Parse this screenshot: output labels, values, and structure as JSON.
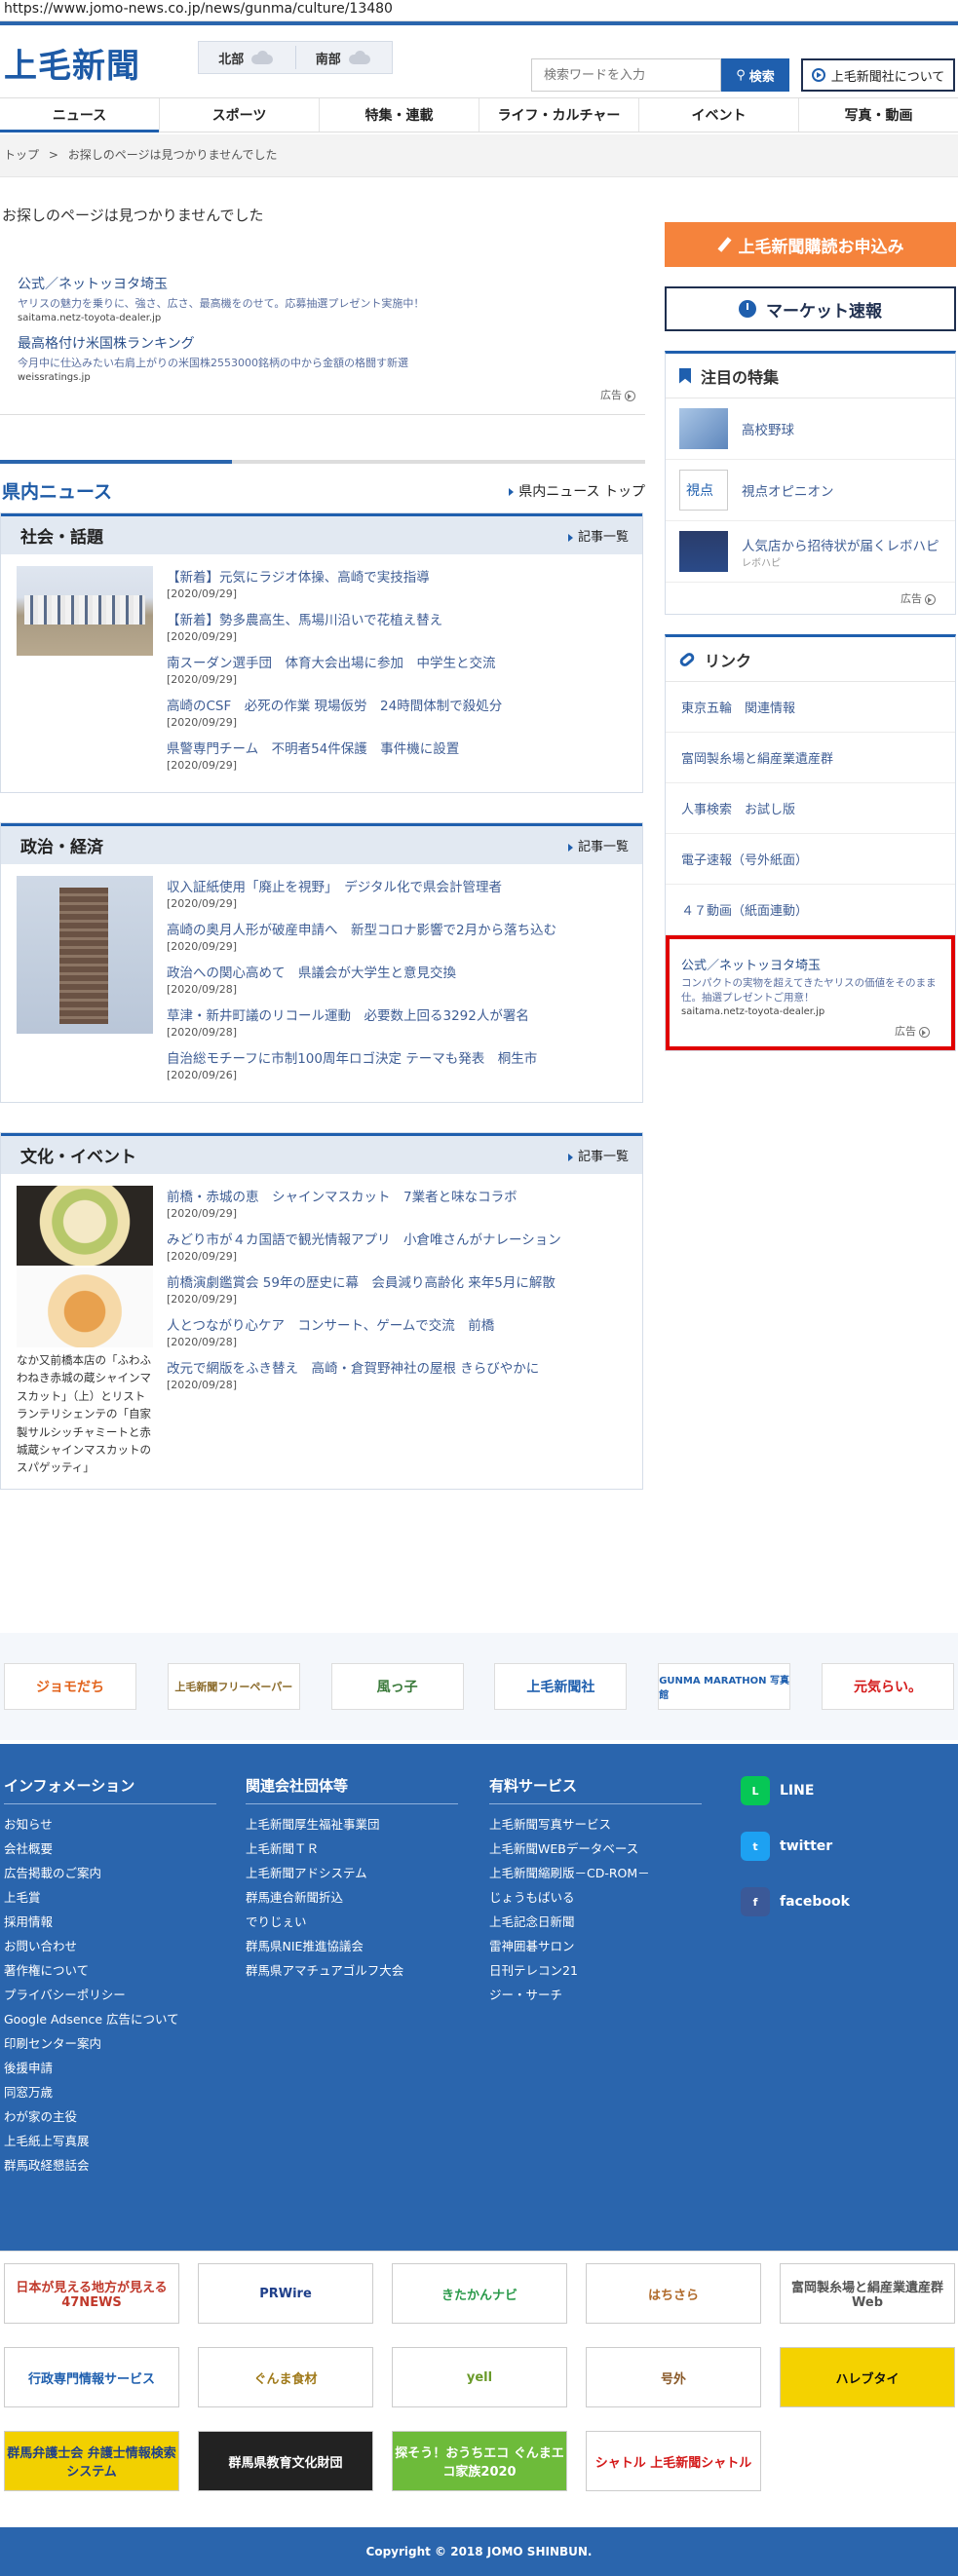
{
  "url": "https://www.jomo-news.co.jp/news/gunma/culture/13480",
  "header": {
    "logo": "上毛新聞",
    "weather": [
      {
        "area": "北部"
      },
      {
        "area": "南部"
      }
    ],
    "search_placeholder": "検索ワードを入力",
    "search_label": "検索",
    "about_label": "上毛新聞社について"
  },
  "nav": [
    "ニュース",
    "スポーツ",
    "特集・連載",
    "ライフ・カルチャー",
    "イベント",
    "写真・動画"
  ],
  "breadcrumb": {
    "home": "トップ",
    "sep": ">",
    "current": "お探しのページは見つかりませんでした"
  },
  "notfound": "お探しのページは見つかりませんでした",
  "ads": [
    {
      "title": "公式／ネットッヨタ埼玉",
      "desc": "ヤリスの魅力を乗りに、強さ、広さ、最高機をのせて。応募抽選プレゼント実施中！",
      "url": "saitama.netz-toyota-dealer.jp"
    },
    {
      "title": "最高格付け米国株ランキング",
      "desc": "今月中に仕込みたい右肩上がりの米国株2553000銘柄の中から金額の格闘す新選",
      "url": "weissratings.jp"
    }
  ],
  "ad_label": "広告",
  "progress": 0.36,
  "kennai": {
    "title": "県内ニュース",
    "link": "県内ニュース トップ"
  },
  "sections": [
    {
      "title": "社会・話題",
      "more": "記事一覧",
      "articles": [
        {
          "title": "【新着】元気にラジオ体操、高崎で実技指導",
          "date": "[2020/09/29]"
        },
        {
          "title": "【新着】勢多農高生、馬場川沿いで花植え替え",
          "date": "[2020/09/29]"
        },
        {
          "title": "南スーダン選手団　体育大会出場に参加　中学生と交流",
          "date": "[2020/09/29]"
        },
        {
          "title": "高崎のCSF　必死の作業 現場仮労　24時間体制で殺処分",
          "date": "[2020/09/29]"
        },
        {
          "title": "県警専門チーム　不明者54件保護　事件機に設置",
          "date": "[2020/09/29]"
        }
      ]
    },
    {
      "title": "政治・経済",
      "more": "記事一覧",
      "articles": [
        {
          "title": "収入証紙使用「廃止を視野」　デジタル化で県会計管理者",
          "date": "[2020/09/29]"
        },
        {
          "title": "高崎の奥月人形が破産申請へ　新型コロナ影響で2月から落ち込む",
          "date": "[2020/09/29]"
        },
        {
          "title": "政治への関心高めて　県議会が大学生と意見交換",
          "date": "[2020/09/28]"
        },
        {
          "title": "草津・新井町議のリコール運動　必要数上回る3292人が署名",
          "date": "[2020/09/28]"
        },
        {
          "title": "自治総モチーフに市制100周年ロゴ決定 テーマも発表　桐生市",
          "date": "[2020/09/26]"
        }
      ]
    },
    {
      "title": "文化・イベント",
      "more": "記事一覧",
      "caption": "なか又前橋本店の「ふわふわねき赤城の蔵シャインマスカット」（上）とリストランテリシェンテの「自家製サルシッチャミートと赤城蔵シャインマスカットのスパゲッティ」",
      "articles": [
        {
          "title": "前橋・赤城の恵　シャインマスカット　7業者と味なコラボ",
          "date": "[2020/09/29]"
        },
        {
          "title": "みどり市が４カ国語で観光情報アプリ　小倉唯さんがナレーション",
          "date": "[2020/09/29]"
        },
        {
          "title": "前橋演劇鑑賞会 59年の歴史に幕　会員減り高齢化 来年5月に解散",
          "date": "[2020/09/29]"
        },
        {
          "title": "人とつながり心ケア　コンサート、ゲームで交流　前橋",
          "date": "[2020/09/28]"
        },
        {
          "title": "改元で網版をふき替え　高崎・倉賀野神社の屋根 きらびやかに",
          "date": "[2020/09/28]"
        }
      ]
    }
  ],
  "side": {
    "apply": "上毛新聞購読お申込み",
    "market": "マーケット速報",
    "features_title": "注目の特集",
    "features": [
      {
        "name": "高校野球",
        "sub": ""
      },
      {
        "name": "視点オピニオン",
        "sub": ""
      },
      {
        "name": "人気店から招待状が届くレボハピ",
        "sub": "レボハピ"
      }
    ],
    "links_title": "リンク",
    "links": [
      "東京五輪　関連情報",
      "富岡製糸場と絹産業遺産群",
      "人事検索　お試し版",
      "電子速報（号外紙面）",
      "４７動画（紙面連動）"
    ],
    "red_ad": {
      "title": "公式／ネットッヨタ埼玉",
      "desc": "コンパクトの実物を超えてきたヤリスの価値をそのまま仕。抽選プレゼントご用意！",
      "url": "saitama.netz-toyota-dealer.jp"
    }
  },
  "banners_top": [
    "ジョモだち",
    "上毛新聞フリーペーパー",
    "風っ子",
    "上毛新聞社",
    "GUNMA MARATHON 写真館",
    "元気らい。"
  ],
  "footer": {
    "cols": [
      {
        "title": "インフォメーション",
        "items": [
          "お知らせ",
          "会社概要",
          "広告掲載のご案内",
          "上毛賞",
          "採用情報",
          "お問い合わせ",
          "著作権について",
          "プライバシーポリシー",
          "Google Adsence 広告について",
          "印刷センター案内",
          "後援申請",
          "同窓万歳",
          "わが家の主役",
          "上毛紙上写真展",
          "群馬政経懇話会"
        ]
      },
      {
        "title": "関連会社団体等",
        "items": [
          "上毛新聞厚生福祉事業団",
          "上毛新聞ＴＲ",
          "上毛新聞アドシステム",
          "群馬連合新聞折込",
          "でりじぇい",
          "群馬県NIE推進協議会",
          "群馬県アマチュアゴルフ大会"
        ]
      },
      {
        "title": "有料サービス",
        "items": [
          "上毛新聞写真サービス",
          "上毛新聞WEBデータベース",
          "上毛新聞縮刷版－CD-ROM－",
          "じょうもばいる",
          "上毛記念日新聞",
          "雷神囲碁サロン",
          "日刊テレコン21",
          "ジー・サーチ"
        ]
      }
    ],
    "social": [
      "LINE",
      "twitter",
      "facebook"
    ]
  },
  "banners_bottom": [
    "日本が見える地方が見える 47NEWS",
    "PRWire",
    "きたかんナビ",
    "はちさら",
    "富岡製糸場と絹産業遺産群Web",
    "行政専門情報サービス",
    "ぐんま食材",
    "yell",
    "号外",
    "ハレブタイ",
    "群馬弁護士会 弁護士情報検索システム",
    "群馬県教育文化財団",
    "探そう！おうちエコ ぐんまエコ家族2020",
    "シャトル 上毛新聞シャトル"
  ],
  "copyright": "Copyright © 2018 JOMO SHINBUN."
}
